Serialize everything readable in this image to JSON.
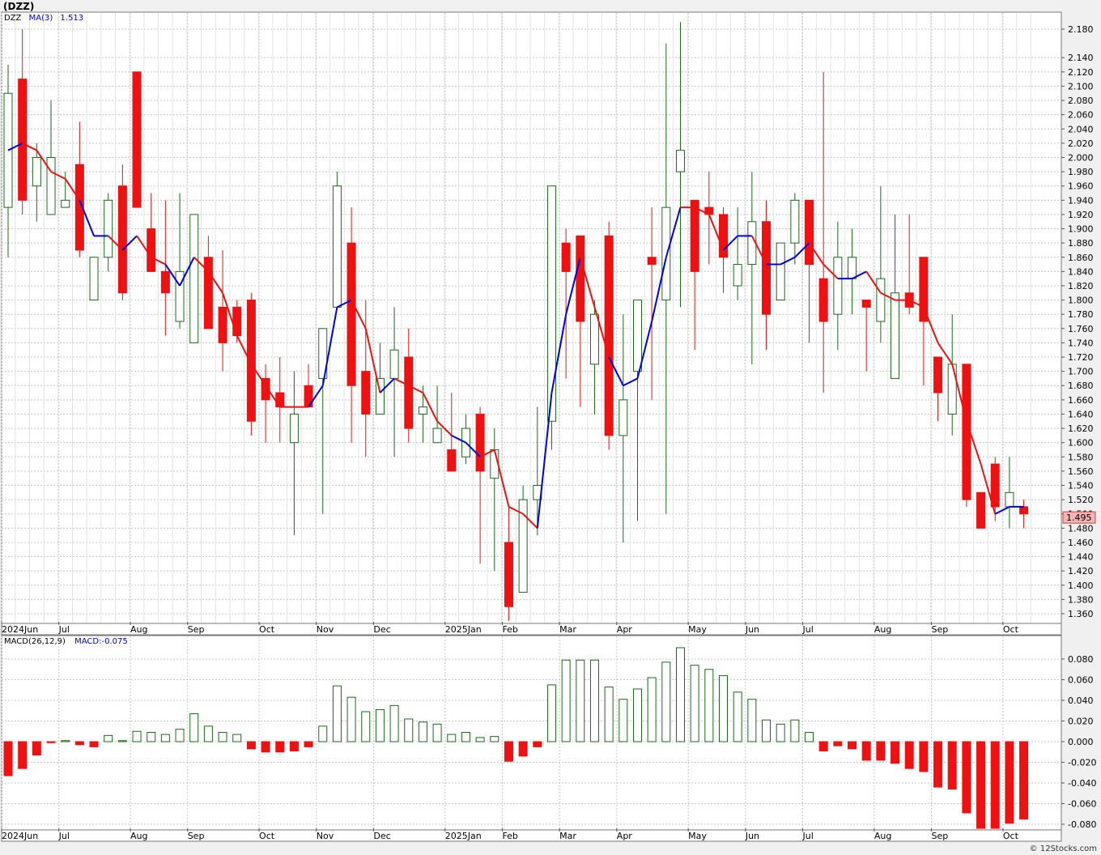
{
  "symbol_title": "(DZZ)",
  "credit": "© 12Stocks.com",
  "colors": {
    "up": "#1a6b1a",
    "down": "#ee1111",
    "ma_up": "#0000dd",
    "ma_down": "#ee1111",
    "grid": "#c8c8c8",
    "badge": "#f4b4b4"
  },
  "price_panel": {
    "symbol_label": "DZZ",
    "ma_label": "MA(3)",
    "ma_value": "1.513",
    "last_price": "1.495"
  },
  "macd_panel": {
    "label": "MACD(26,12,9)",
    "value_label": "MACD:-0.075"
  },
  "chart_data": [
    {
      "type": "candlestick",
      "title": "(DZZ)",
      "ylim": [
        1.35,
        2.2
      ],
      "y_ticks": [
        "2.180",
        "2.140",
        "2.120",
        "2.100",
        "2.080",
        "2.060",
        "2.040",
        "2.020",
        "2.000",
        "1.980",
        "1.960",
        "1.940",
        "1.920",
        "1.900",
        "1.880",
        "1.860",
        "1.840",
        "1.820",
        "1.800",
        "1.780",
        "1.760",
        "1.740",
        "1.720",
        "1.700",
        "1.680",
        "1.660",
        "1.640",
        "1.620",
        "1.600",
        "1.580",
        "1.560",
        "1.540",
        "1.520",
        "1.500",
        "1.480",
        "1.460",
        "1.440",
        "1.420",
        "1.400",
        "1.380",
        "1.360"
      ],
      "x_labels": [
        {
          "label": "2024Jun",
          "week": 0
        },
        {
          "label": "Jul",
          "week": 4
        },
        {
          "label": "Aug",
          "week": 9
        },
        {
          "label": "Sep",
          "week": 13
        },
        {
          "label": "Oct",
          "week": 18
        },
        {
          "label": "Nov",
          "week": 22
        },
        {
          "label": "Dec",
          "week": 26
        },
        {
          "label": "2025Jan",
          "week": 31
        },
        {
          "label": "Feb",
          "week": 35
        },
        {
          "label": "Mar",
          "week": 39
        },
        {
          "label": "Apr",
          "week": 43
        },
        {
          "label": "May",
          "week": 48
        },
        {
          "label": "Jun",
          "week": 52
        },
        {
          "label": "Jul",
          "week": 56
        },
        {
          "label": "Aug",
          "week": 61
        },
        {
          "label": "Sep",
          "week": 65
        },
        {
          "label": "Oct",
          "week": 70
        }
      ],
      "candles": [
        {
          "o": 1.93,
          "h": 2.13,
          "l": 1.86,
          "c": 2.09
        },
        {
          "o": 2.11,
          "h": 2.18,
          "l": 1.92,
          "c": 1.94
        },
        {
          "o": 1.96,
          "h": 2.02,
          "l": 1.91,
          "c": 2.0
        },
        {
          "o": 1.92,
          "h": 2.08,
          "l": 1.92,
          "c": 2.0
        },
        {
          "o": 1.93,
          "h": 1.98,
          "l": 1.93,
          "c": 1.94
        },
        {
          "o": 1.99,
          "h": 2.05,
          "l": 1.86,
          "c": 1.87
        },
        {
          "o": 1.8,
          "h": 1.86,
          "l": 1.8,
          "c": 1.86
        },
        {
          "o": 1.86,
          "h": 1.95,
          "l": 1.84,
          "c": 1.94
        },
        {
          "o": 1.96,
          "h": 1.99,
          "l": 1.8,
          "c": 1.81
        },
        {
          "o": 2.12,
          "h": 2.12,
          "l": 1.93,
          "c": 1.93
        },
        {
          "o": 1.9,
          "h": 1.95,
          "l": 1.84,
          "c": 1.84
        },
        {
          "o": 1.84,
          "h": 1.94,
          "l": 1.75,
          "c": 1.81
        },
        {
          "o": 1.77,
          "h": 1.95,
          "l": 1.76,
          "c": 1.84
        },
        {
          "o": 1.74,
          "h": 1.92,
          "l": 1.74,
          "c": 1.92
        },
        {
          "o": 1.86,
          "h": 1.89,
          "l": 1.76,
          "c": 1.76
        },
        {
          "o": 1.79,
          "h": 1.87,
          "l": 1.7,
          "c": 1.74
        },
        {
          "o": 1.79,
          "h": 1.8,
          "l": 1.74,
          "c": 1.75
        },
        {
          "o": 1.8,
          "h": 1.81,
          "l": 1.61,
          "c": 1.63
        },
        {
          "o": 1.69,
          "h": 1.71,
          "l": 1.6,
          "c": 1.66
        },
        {
          "o": 1.67,
          "h": 1.72,
          "l": 1.6,
          "c": 1.65
        },
        {
          "o": 1.6,
          "h": 1.7,
          "l": 1.47,
          "c": 1.64
        },
        {
          "o": 1.68,
          "h": 1.71,
          "l": 1.65,
          "c": 1.65
        },
        {
          "o": 1.69,
          "h": 1.76,
          "l": 1.5,
          "c": 1.76
        },
        {
          "o": 1.79,
          "h": 1.98,
          "l": 1.79,
          "c": 1.96
        },
        {
          "o": 1.88,
          "h": 1.93,
          "l": 1.6,
          "c": 1.68
        },
        {
          "o": 1.7,
          "h": 1.8,
          "l": 1.58,
          "c": 1.64
        },
        {
          "o": 1.64,
          "h": 1.74,
          "l": 1.64,
          "c": 1.69
        },
        {
          "o": 1.69,
          "h": 1.79,
          "l": 1.58,
          "c": 1.73
        },
        {
          "o": 1.72,
          "h": 1.76,
          "l": 1.6,
          "c": 1.62
        },
        {
          "o": 1.64,
          "h": 1.68,
          "l": 1.6,
          "c": 1.65
        },
        {
          "o": 1.6,
          "h": 1.68,
          "l": 1.6,
          "c": 1.62
        },
        {
          "o": 1.59,
          "h": 1.67,
          "l": 1.56,
          "c": 1.56
        },
        {
          "o": 1.58,
          "h": 1.64,
          "l": 1.57,
          "c": 1.62
        },
        {
          "o": 1.64,
          "h": 1.65,
          "l": 1.43,
          "c": 1.56
        },
        {
          "o": 1.55,
          "h": 1.62,
          "l": 1.42,
          "c": 1.59
        },
        {
          "o": 1.46,
          "h": 1.51,
          "l": 1.35,
          "c": 1.37
        },
        {
          "o": 1.39,
          "h": 1.54,
          "l": 1.39,
          "c": 1.52
        },
        {
          "o": 1.52,
          "h": 1.65,
          "l": 1.47,
          "c": 1.54
        },
        {
          "o": 1.63,
          "h": 1.96,
          "l": 1.59,
          "c": 1.96
        },
        {
          "o": 1.88,
          "h": 1.9,
          "l": 1.69,
          "c": 1.84
        },
        {
          "o": 1.89,
          "h": 1.89,
          "l": 1.65,
          "c": 1.77
        },
        {
          "o": 1.71,
          "h": 1.8,
          "l": 1.64,
          "c": 1.78
        },
        {
          "o": 1.89,
          "h": 1.91,
          "l": 1.59,
          "c": 1.61
        },
        {
          "o": 1.61,
          "h": 1.78,
          "l": 1.46,
          "c": 1.66
        },
        {
          "o": 1.7,
          "h": 1.8,
          "l": 1.49,
          "c": 1.8
        },
        {
          "o": 1.86,
          "h": 1.93,
          "l": 1.66,
          "c": 1.85
        },
        {
          "o": 1.8,
          "h": 2.16,
          "l": 1.5,
          "c": 1.93
        },
        {
          "o": 1.98,
          "h": 2.19,
          "l": 1.79,
          "c": 2.01
        },
        {
          "o": 1.94,
          "h": 1.94,
          "l": 1.73,
          "c": 1.84
        },
        {
          "o": 1.93,
          "h": 1.98,
          "l": 1.85,
          "c": 1.92
        },
        {
          "o": 1.92,
          "h": 1.93,
          "l": 1.81,
          "c": 1.86
        },
        {
          "o": 1.82,
          "h": 1.93,
          "l": 1.8,
          "c": 1.85
        },
        {
          "o": 1.85,
          "h": 1.98,
          "l": 1.71,
          "c": 1.91
        },
        {
          "o": 1.91,
          "h": 1.94,
          "l": 1.73,
          "c": 1.78
        },
        {
          "o": 1.8,
          "h": 1.88,
          "l": 1.8,
          "c": 1.88
        },
        {
          "o": 1.88,
          "h": 1.95,
          "l": 1.85,
          "c": 1.94
        },
        {
          "o": 1.94,
          "h": 1.94,
          "l": 1.74,
          "c": 1.85
        },
        {
          "o": 1.83,
          "h": 2.12,
          "l": 1.67,
          "c": 1.77
        },
        {
          "o": 1.78,
          "h": 1.91,
          "l": 1.73,
          "c": 1.86
        },
        {
          "o": 1.83,
          "h": 1.9,
          "l": 1.78,
          "c": 1.86
        },
        {
          "o": 1.8,
          "h": 1.8,
          "l": 1.7,
          "c": 1.79
        },
        {
          "o": 1.77,
          "h": 1.96,
          "l": 1.74,
          "c": 1.83
        },
        {
          "o": 1.69,
          "h": 1.92,
          "l": 1.69,
          "c": 1.81
        },
        {
          "o": 1.81,
          "h": 1.92,
          "l": 1.78,
          "c": 1.79
        },
        {
          "o": 1.86,
          "h": 1.86,
          "l": 1.68,
          "c": 1.77
        },
        {
          "o": 1.72,
          "h": 1.72,
          "l": 1.63,
          "c": 1.67
        },
        {
          "o": 1.64,
          "h": 1.78,
          "l": 1.61,
          "c": 1.71
        },
        {
          "o": 1.71,
          "h": 1.71,
          "l": 1.51,
          "c": 1.52
        },
        {
          "o": 1.53,
          "h": 1.53,
          "l": 1.48,
          "c": 1.48
        },
        {
          "o": 1.57,
          "h": 1.58,
          "l": 1.49,
          "c": 1.51
        },
        {
          "o": 1.51,
          "h": 1.58,
          "l": 1.48,
          "c": 1.53
        },
        {
          "o": 1.51,
          "h": 1.52,
          "l": 1.48,
          "c": 1.5
        }
      ],
      "ma3": [
        2.01,
        2.02,
        2.01,
        1.98,
        1.97,
        1.94,
        1.89,
        1.89,
        1.87,
        1.89,
        1.86,
        1.85,
        1.82,
        1.86,
        1.84,
        1.81,
        1.75,
        1.71,
        1.68,
        1.65,
        1.65,
        1.65,
        1.68,
        1.79,
        1.8,
        1.76,
        1.67,
        1.69,
        1.68,
        1.67,
        1.63,
        1.61,
        1.6,
        1.58,
        1.59,
        1.51,
        1.5,
        1.48,
        1.67,
        1.78,
        1.86,
        1.79,
        1.72,
        1.68,
        1.69,
        1.77,
        1.86,
        1.93,
        1.93,
        1.92,
        1.87,
        1.89,
        1.89,
        1.85,
        1.85,
        1.86,
        1.88,
        1.85,
        1.83,
        1.83,
        1.84,
        1.81,
        1.8,
        1.8,
        1.79,
        1.74,
        1.71,
        1.63,
        1.57,
        1.5,
        1.51,
        1.51
      ],
      "ma_color": [
        "up",
        "up",
        "down",
        "down",
        "down",
        "down",
        "up",
        "up",
        "down",
        "up",
        "down",
        "down",
        "up",
        "up",
        "down",
        "down",
        "down",
        "down",
        "down",
        "down",
        "down",
        "down",
        "up",
        "up",
        "up",
        "down",
        "down",
        "up",
        "down",
        "down",
        "down",
        "down",
        "up",
        "up",
        "down",
        "down",
        "down",
        "down",
        "up",
        "up",
        "up",
        "down",
        "down",
        "up",
        "up",
        "up",
        "up",
        "up",
        "down",
        "down",
        "down",
        "up",
        "up",
        "down",
        "up",
        "up",
        "up",
        "down",
        "down",
        "up",
        "up",
        "down",
        "down",
        "down",
        "down",
        "down",
        "down",
        "down",
        "down",
        "down",
        "up",
        "up"
      ]
    },
    {
      "type": "bar",
      "title": "MACD(26,12,9)",
      "ylim": [
        -0.085,
        0.095
      ],
      "y_ticks": [
        "0.080",
        "0.060",
        "0.040",
        "0.020",
        "0.000",
        "-0.020",
        "-0.040",
        "-0.060",
        "-0.080"
      ],
      "values": [
        -0.033,
        -0.026,
        -0.013,
        -0.001,
        0.001,
        -0.003,
        -0.005,
        0.006,
        0.001,
        0.01,
        0.009,
        0.007,
        0.012,
        0.027,
        0.015,
        0.009,
        0.007,
        -0.007,
        -0.01,
        -0.01,
        -0.009,
        -0.005,
        0.015,
        0.054,
        0.043,
        0.029,
        0.031,
        0.035,
        0.022,
        0.019,
        0.017,
        0.007,
        0.009,
        0.004,
        0.005,
        -0.019,
        -0.014,
        -0.005,
        0.055,
        0.079,
        0.079,
        0.079,
        0.053,
        0.041,
        0.051,
        0.062,
        0.077,
        0.091,
        0.074,
        0.07,
        0.064,
        0.048,
        0.041,
        0.021,
        0.017,
        0.021,
        0.009,
        -0.009,
        -0.004,
        -0.007,
        -0.018,
        -0.018,
        -0.021,
        -0.026,
        -0.029,
        -0.044,
        -0.046,
        -0.069,
        -0.084,
        -0.084,
        -0.079,
        -0.075
      ]
    }
  ]
}
